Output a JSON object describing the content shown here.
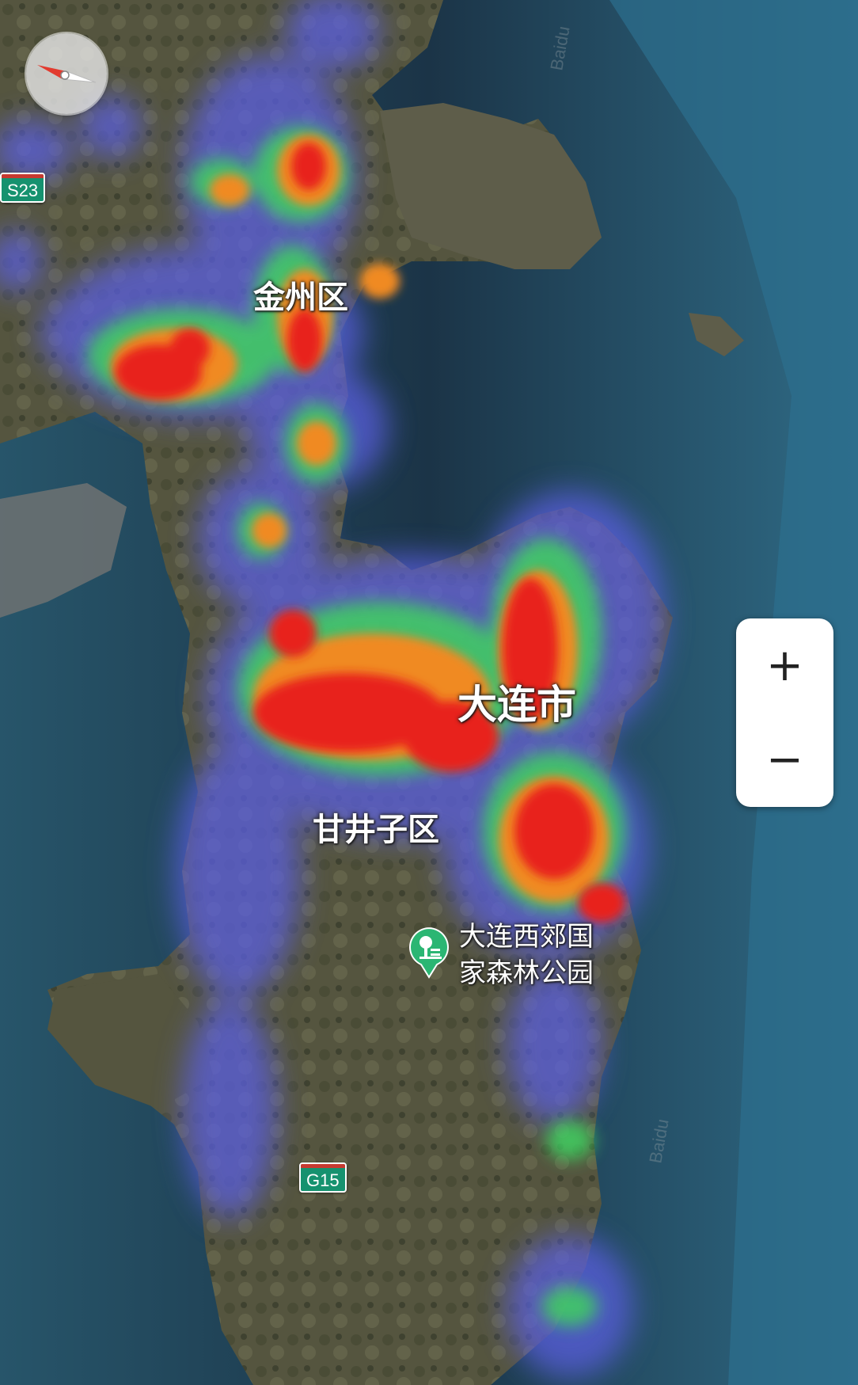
{
  "map": {
    "view": "satellite",
    "overlay": "heatmap",
    "heatmap_scale": [
      "#5a5ee0",
      "#3bb8c8",
      "#40d060",
      "#f0e030",
      "#f08a20",
      "#e8201c"
    ]
  },
  "labels": {
    "jinzhou": "金州区",
    "dalian": "大连市",
    "ganjingzi": "甘井子区",
    "park": "大连西郊国家森林公园"
  },
  "road_shields": {
    "s23": "S23",
    "g15": "G15"
  },
  "controls": {
    "zoom_in": "+",
    "zoom_out": "−"
  },
  "icons": {
    "compass": "compass-icon",
    "park": "forest-park-pin-icon"
  },
  "colors": {
    "sea": "#1f4a62",
    "land": "#5a5a44",
    "shield": "#16926f",
    "poi_green": "#2bb673"
  }
}
